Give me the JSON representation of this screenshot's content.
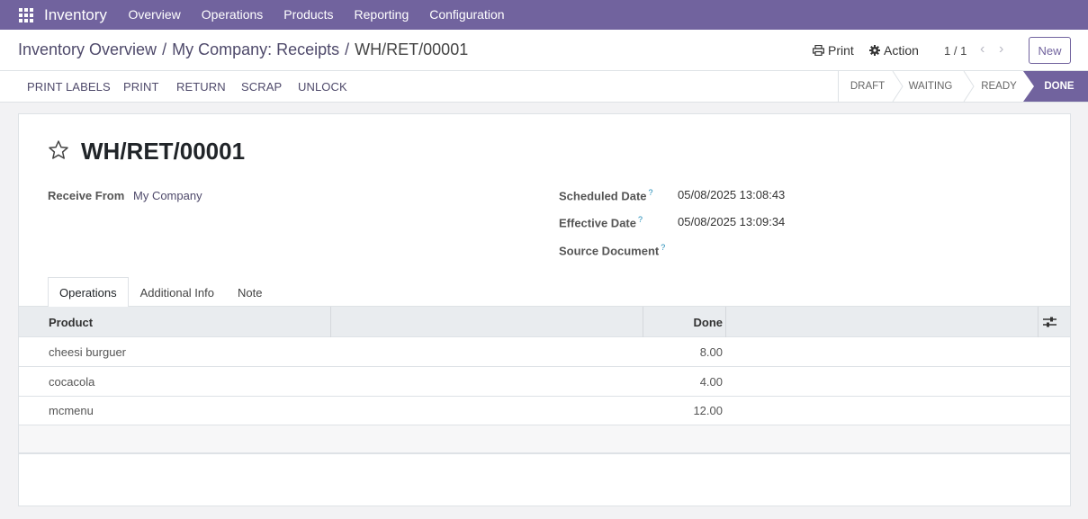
{
  "nav": {
    "app_name": "Inventory",
    "items": [
      "Overview",
      "Operations",
      "Products",
      "Reporting",
      "Configuration"
    ]
  },
  "breadcrumb": {
    "items": [
      "Inventory Overview",
      "My Company: Receipts",
      "WH/RET/00001"
    ],
    "separator": "/"
  },
  "control": {
    "print_label": "Print",
    "action_label": "Action",
    "pager": "1 / 1",
    "new_label": "New"
  },
  "actions": [
    "PRINT LABELS",
    "PRINT",
    "RETURN",
    "SCRAP",
    "UNLOCK"
  ],
  "stages": {
    "items": [
      "DRAFT",
      "WAITING",
      "READY",
      "DONE"
    ],
    "current": "DONE"
  },
  "record": {
    "title": "WH/RET/00001",
    "receive_from_label": "Receive From",
    "receive_from": "My Company",
    "scheduled_date_label": "Scheduled Date",
    "scheduled_date": "05/08/2025 13:08:43",
    "effective_date_label": "Effective Date",
    "effective_date": "05/08/2025 13:09:34",
    "source_document_label": "Source Document",
    "help_mark": "?"
  },
  "tabs": [
    "Operations",
    "Additional Info",
    "Note"
  ],
  "table": {
    "columns": [
      "Product",
      "Done"
    ],
    "rows": [
      {
        "product": "cheesi burguer",
        "done": "8.00"
      },
      {
        "product": "cocacola",
        "done": "4.00"
      },
      {
        "product": "mcmenu",
        "done": "12.00"
      }
    ]
  },
  "colors": {
    "brand": "#71639e",
    "link": "#4f4a6b",
    "help": "#1f8ab6"
  }
}
